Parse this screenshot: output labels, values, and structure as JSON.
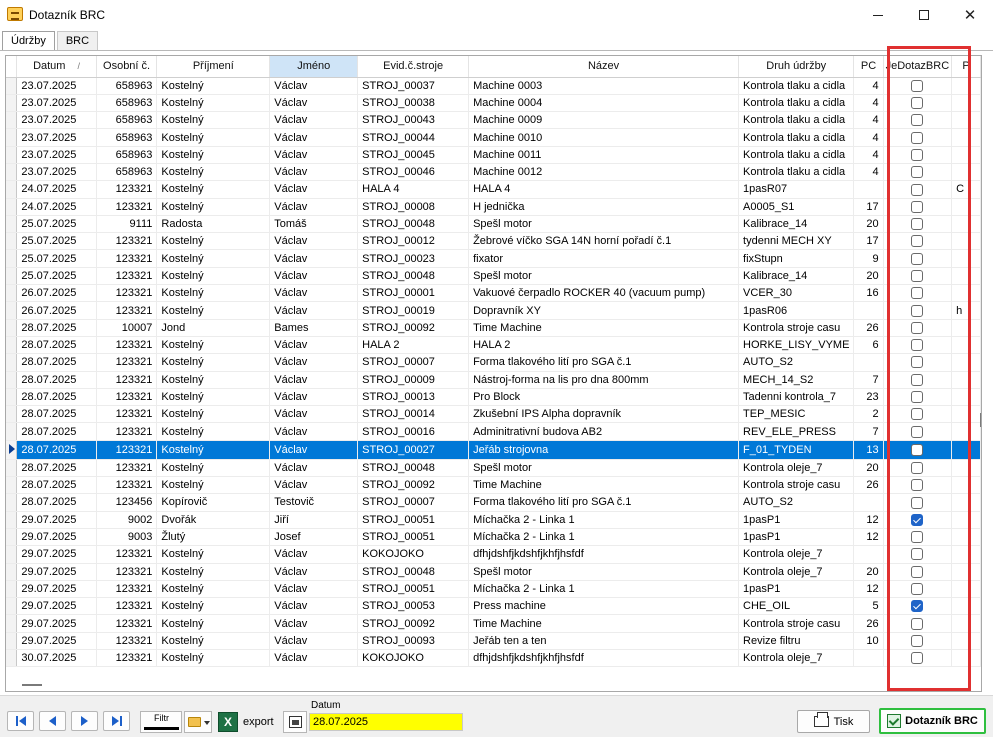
{
  "window": {
    "title": "Dotazník BRC"
  },
  "tabs": [
    {
      "label": "Údržby"
    },
    {
      "label": "BRC"
    }
  ],
  "grid": {
    "columns": {
      "datum": "Datum",
      "sort_indicator": "/",
      "osobni": "Osobní č.",
      "prijmeni": "Příjmení",
      "jmeno": "Jméno",
      "evid": "Evid.č.stroje",
      "nazev": "Název",
      "druh": "Druh údržby",
      "pc": "PC",
      "jedotaz": "JeDotazBRC",
      "p": "P"
    },
    "sorted_column": "Jméno",
    "selected_row_index": 21,
    "rows": [
      {
        "datum": "23.07.2025",
        "osobni": "658963",
        "prijmeni": "Kostelný",
        "jmeno": "Václav",
        "evid": "STROJ_00037",
        "nazev": "Machine 0003",
        "druh": "Kontrola tlaku a cidla",
        "pc": "4",
        "jedotaz": false,
        "p": ""
      },
      {
        "datum": "23.07.2025",
        "osobni": "658963",
        "prijmeni": "Kostelný",
        "jmeno": "Václav",
        "evid": "STROJ_00038",
        "nazev": "Machine 0004",
        "druh": "Kontrola tlaku a cidla",
        "pc": "4",
        "jedotaz": false,
        "p": ""
      },
      {
        "datum": "23.07.2025",
        "osobni": "658963",
        "prijmeni": "Kostelný",
        "jmeno": "Václav",
        "evid": "STROJ_00043",
        "nazev": "Machine 0009",
        "druh": "Kontrola tlaku a cidla",
        "pc": "4",
        "jedotaz": false,
        "p": ""
      },
      {
        "datum": "23.07.2025",
        "osobni": "658963",
        "prijmeni": "Kostelný",
        "jmeno": "Václav",
        "evid": "STROJ_00044",
        "nazev": "Machine 0010",
        "druh": "Kontrola tlaku a cidla",
        "pc": "4",
        "jedotaz": false,
        "p": ""
      },
      {
        "datum": "23.07.2025",
        "osobni": "658963",
        "prijmeni": "Kostelný",
        "jmeno": "Václav",
        "evid": "STROJ_00045",
        "nazev": "Machine 0011",
        "druh": "Kontrola tlaku a cidla",
        "pc": "4",
        "jedotaz": false,
        "p": ""
      },
      {
        "datum": "23.07.2025",
        "osobni": "658963",
        "prijmeni": "Kostelný",
        "jmeno": "Václav",
        "evid": "STROJ_00046",
        "nazev": "Machine 0012",
        "druh": "Kontrola tlaku a cidla",
        "pc": "4",
        "jedotaz": false,
        "p": ""
      },
      {
        "datum": "24.07.2025",
        "osobni": "123321",
        "prijmeni": "Kostelný",
        "jmeno": "Václav",
        "evid": "HALA 4",
        "nazev": "HALA 4",
        "druh": "1pasR07",
        "pc": "",
        "jedotaz": false,
        "p": "C"
      },
      {
        "datum": "24.07.2025",
        "osobni": "123321",
        "prijmeni": "Kostelný",
        "jmeno": "Václav",
        "evid": "STROJ_00008",
        "nazev": "H jednička",
        "druh": "A0005_S1",
        "pc": "17",
        "jedotaz": false,
        "p": ""
      },
      {
        "datum": "25.07.2025",
        "osobni": "9111",
        "prijmeni": "Radosta",
        "jmeno": "Tomáš",
        "evid": "STROJ_00048",
        "nazev": "Spešl motor",
        "druh": "Kalibrace_14",
        "pc": "20",
        "jedotaz": false,
        "p": ""
      },
      {
        "datum": "25.07.2025",
        "osobni": "123321",
        "prijmeni": "Kostelný",
        "jmeno": "Václav",
        "evid": "STROJ_00012",
        "nazev": "Žebrové víčko SGA 14N horní pořadí č.1",
        "druh": "tydenni MECH XY",
        "pc": "17",
        "jedotaz": false,
        "p": ""
      },
      {
        "datum": "25.07.2025",
        "osobni": "123321",
        "prijmeni": "Kostelný",
        "jmeno": "Václav",
        "evid": "STROJ_00023",
        "nazev": "fixator",
        "druh": "fixStupn",
        "pc": "9",
        "jedotaz": false,
        "p": ""
      },
      {
        "datum": "25.07.2025",
        "osobni": "123321",
        "prijmeni": "Kostelný",
        "jmeno": "Václav",
        "evid": "STROJ_00048",
        "nazev": "Spešl motor",
        "druh": "Kalibrace_14",
        "pc": "20",
        "jedotaz": false,
        "p": ""
      },
      {
        "datum": "26.07.2025",
        "osobni": "123321",
        "prijmeni": "Kostelný",
        "jmeno": "Václav",
        "evid": "STROJ_00001",
        "nazev": "Vakuové čerpadlo ROCKER 40 (vacuum pump)",
        "druh": "VCER_30",
        "pc": "16",
        "jedotaz": false,
        "p": ""
      },
      {
        "datum": "26.07.2025",
        "osobni": "123321",
        "prijmeni": "Kostelný",
        "jmeno": "Václav",
        "evid": "STROJ_00019",
        "nazev": "Dopravník XY",
        "druh": "1pasR06",
        "pc": "",
        "jedotaz": false,
        "p": "h"
      },
      {
        "datum": "28.07.2025",
        "osobni": "10007",
        "prijmeni": "Jond",
        "jmeno": "Bames",
        "evid": "STROJ_00092",
        "nazev": "Time Machine",
        "druh": "Kontrola stroje casu",
        "pc": "26",
        "jedotaz": false,
        "p": ""
      },
      {
        "datum": "28.07.2025",
        "osobni": "123321",
        "prijmeni": "Kostelný",
        "jmeno": "Václav",
        "evid": "HALA 2",
        "nazev": "HALA 2",
        "druh": "HORKE_LISY_VYME",
        "pc": "6",
        "jedotaz": false,
        "p": ""
      },
      {
        "datum": "28.07.2025",
        "osobni": "123321",
        "prijmeni": "Kostelný",
        "jmeno": "Václav",
        "evid": "STROJ_00007",
        "nazev": "Forma tlakového lití pro SGA č.1",
        "druh": "AUTO_S2",
        "pc": "",
        "jedotaz": false,
        "p": ""
      },
      {
        "datum": "28.07.2025",
        "osobni": "123321",
        "prijmeni": "Kostelný",
        "jmeno": "Václav",
        "evid": "STROJ_00009",
        "nazev": "Nástroj-forma na lis pro dna 800mm",
        "druh": "MECH_14_S2",
        "pc": "7",
        "jedotaz": false,
        "p": ""
      },
      {
        "datum": "28.07.2025",
        "osobni": "123321",
        "prijmeni": "Kostelný",
        "jmeno": "Václav",
        "evid": "STROJ_00013",
        "nazev": "Pro Block",
        "druh": "Tadenni kontrola_7",
        "pc": "23",
        "jedotaz": false,
        "p": ""
      },
      {
        "datum": "28.07.2025",
        "osobni": "123321",
        "prijmeni": "Kostelný",
        "jmeno": "Václav",
        "evid": "STROJ_00014",
        "nazev": "Zkušební IPS Alpha dopravník",
        "druh": "TEP_MESIC",
        "pc": "2",
        "jedotaz": false,
        "p": ""
      },
      {
        "datum": "28.07.2025",
        "osobni": "123321",
        "prijmeni": "Kostelný",
        "jmeno": "Václav",
        "evid": "STROJ_00016",
        "nazev": "Adminitrativní budova AB2",
        "druh": "REV_ELE_PRESS",
        "pc": "7",
        "jedotaz": false,
        "p": ""
      },
      {
        "datum": "28.07.2025",
        "osobni": "123321",
        "prijmeni": "Kostelný",
        "jmeno": "Václav",
        "evid": "STROJ_00027",
        "nazev": "Jeřáb strojovna",
        "druh": "F_01_TYDEN",
        "pc": "13",
        "jedotaz": false,
        "p": ""
      },
      {
        "datum": "28.07.2025",
        "osobni": "123321",
        "prijmeni": "Kostelný",
        "jmeno": "Václav",
        "evid": "STROJ_00048",
        "nazev": "Spešl motor",
        "druh": "Kontrola oleje_7",
        "pc": "20",
        "jedotaz": false,
        "p": ""
      },
      {
        "datum": "28.07.2025",
        "osobni": "123321",
        "prijmeni": "Kostelný",
        "jmeno": "Václav",
        "evid": "STROJ_00092",
        "nazev": "Time Machine",
        "druh": "Kontrola stroje casu",
        "pc": "26",
        "jedotaz": false,
        "p": ""
      },
      {
        "datum": "28.07.2025",
        "osobni": "123456",
        "prijmeni": "Kopírovič",
        "jmeno": "Testovič",
        "evid": "STROJ_00007",
        "nazev": "Forma tlakového lití pro SGA č.1",
        "druh": "AUTO_S2",
        "pc": "",
        "jedotaz": false,
        "p": ""
      },
      {
        "datum": "29.07.2025",
        "osobni": "9002",
        "prijmeni": "Dvořák",
        "jmeno": "Jiří",
        "evid": "STROJ_00051",
        "nazev": "Míchačka 2 - Linka 1",
        "druh": "1pasP1",
        "pc": "12",
        "jedotaz": true,
        "p": ""
      },
      {
        "datum": "29.07.2025",
        "osobni": "9003",
        "prijmeni": "Žlutý",
        "jmeno": "Josef",
        "evid": "STROJ_00051",
        "nazev": "Míchačka 2 - Linka 1",
        "druh": "1pasP1",
        "pc": "12",
        "jedotaz": false,
        "p": ""
      },
      {
        "datum": "29.07.2025",
        "osobni": "123321",
        "prijmeni": "Kostelný",
        "jmeno": "Václav",
        "evid": "KOKOJOKO",
        "nazev": "dfhjdshfjkdshfjkhfjhsfdf",
        "druh": "Kontrola oleje_7",
        "pc": "",
        "jedotaz": false,
        "p": ""
      },
      {
        "datum": "29.07.2025",
        "osobni": "123321",
        "prijmeni": "Kostelný",
        "jmeno": "Václav",
        "evid": "STROJ_00048",
        "nazev": "Spešl motor",
        "druh": "Kontrola oleje_7",
        "pc": "20",
        "jedotaz": false,
        "p": ""
      },
      {
        "datum": "29.07.2025",
        "osobni": "123321",
        "prijmeni": "Kostelný",
        "jmeno": "Václav",
        "evid": "STROJ_00051",
        "nazev": "Míchačka 2 - Linka 1",
        "druh": "1pasP1",
        "pc": "12",
        "jedotaz": false,
        "p": ""
      },
      {
        "datum": "29.07.2025",
        "osobni": "123321",
        "prijmeni": "Kostelný",
        "jmeno": "Václav",
        "evid": "STROJ_00053",
        "nazev": "Press machine",
        "druh": "CHE_OIL",
        "pc": "5",
        "jedotaz": true,
        "p": ""
      },
      {
        "datum": "29.07.2025",
        "osobni": "123321",
        "prijmeni": "Kostelný",
        "jmeno": "Václav",
        "evid": "STROJ_00092",
        "nazev": "Time Machine",
        "druh": "Kontrola stroje casu",
        "pc": "26",
        "jedotaz": false,
        "p": ""
      },
      {
        "datum": "29.07.2025",
        "osobni": "123321",
        "prijmeni": "Kostelný",
        "jmeno": "Václav",
        "evid": "STROJ_00093",
        "nazev": "Jeřáb ten a ten",
        "druh": "Revize filtru",
        "pc": "10",
        "jedotaz": false,
        "p": ""
      },
      {
        "datum": "30.07.2025",
        "osobni": "123321",
        "prijmeni": "Kostelný",
        "jmeno": "Václav",
        "evid": "KOKOJOKO",
        "nazev": "dfhjdshfjkdshfjkhfjhsfdf",
        "druh": "Kontrola oleje_7",
        "pc": "",
        "jedotaz": false,
        "p": ""
      }
    ]
  },
  "bottom": {
    "nav": {
      "first": "first-record",
      "prev": "previous-record",
      "next": "next-record",
      "last": "last-record"
    },
    "filtr_label": "Filtr",
    "export_label": "export",
    "datum_label": "Datum",
    "datum_value": "28.07.2025",
    "tisk_label": "Tisk",
    "dotaznik_label": "Dotazník BRC"
  },
  "colors": {
    "selection": "#0078d7",
    "highlight_frame": "#e03030",
    "date_field": "#ffff00",
    "checkbox_checked": "#1f64c8",
    "brc_button_border": "#2fbf3f"
  }
}
